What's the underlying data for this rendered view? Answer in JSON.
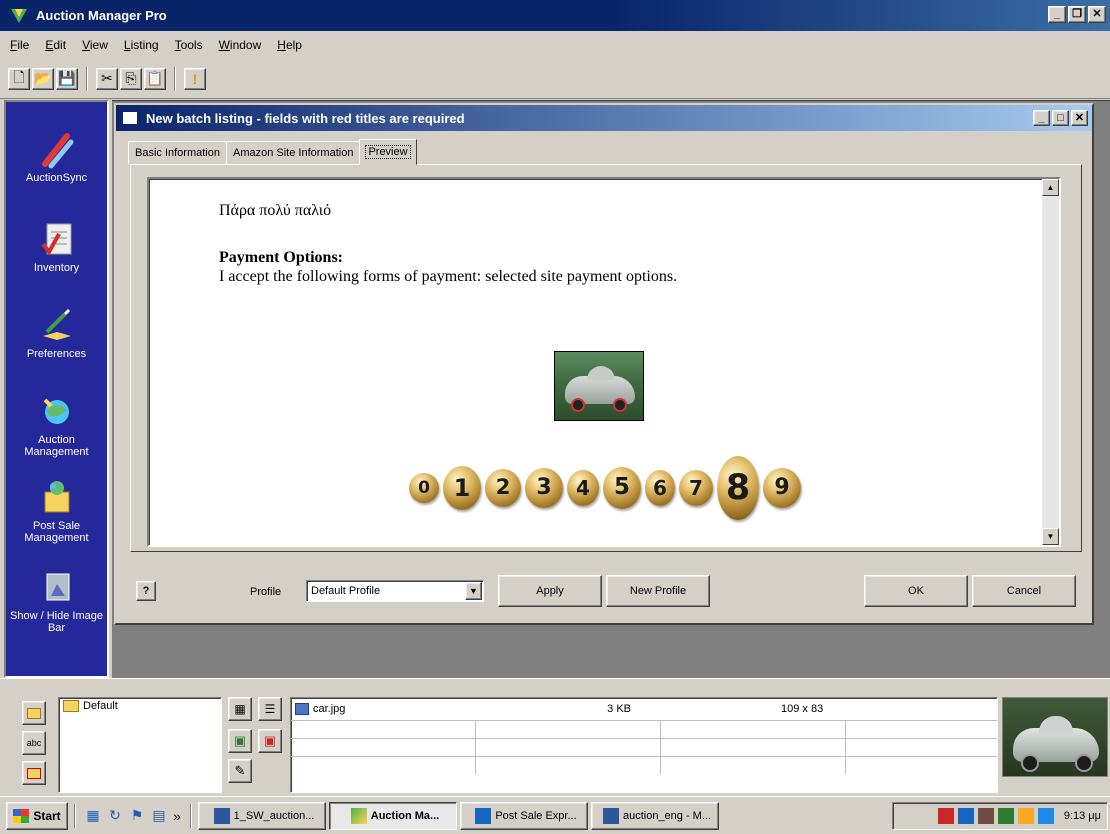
{
  "app": {
    "title": "Auction Manager Pro",
    "menu": [
      "File",
      "Edit",
      "View",
      "Listing",
      "Tools",
      "Window",
      "Help"
    ],
    "toolbar_icons": [
      "new-document-icon",
      "open-folder-icon",
      "save-icon",
      "cut-icon",
      "copy-icon",
      "paste-icon",
      "info-icon"
    ]
  },
  "sidebar": {
    "items": [
      {
        "label": "AuctionSync",
        "icon": "auctionsync-icon"
      },
      {
        "label": "Inventory",
        "icon": "inventory-icon"
      },
      {
        "label": "Preferences",
        "icon": "preferences-icon"
      },
      {
        "label": "Auction Management",
        "icon": "auction-management-icon"
      },
      {
        "label": "Post Sale Management",
        "icon": "post-sale-icon"
      },
      {
        "label": "Show / Hide Image Bar",
        "icon": "image-bar-icon"
      }
    ]
  },
  "dialog": {
    "title": "New batch listing - fields with red titles are required",
    "tabs": [
      "Basic Information",
      "Amazon Site Information",
      "Preview"
    ],
    "active_tab": "Preview",
    "preview": {
      "greek_text": "Πάρα πολύ παλιό",
      "payment_heading": "Payment Options:",
      "payment_text": "I accept the following forms of payment: selected site payment options.",
      "counter_digits": [
        "0",
        "1",
        "2",
        "3",
        "4",
        "5",
        "6",
        "7",
        "8",
        "9"
      ]
    },
    "profile_label": "Profile",
    "profile_value": "Default Profile",
    "buttons": {
      "apply": "Apply",
      "new_profile": "New Profile",
      "ok": "OK",
      "cancel": "Cancel"
    }
  },
  "imagebar": {
    "folder": "Default",
    "file": {
      "name": "car.jpg",
      "size": "3 KB",
      "dimensions": "109 x 83"
    }
  },
  "taskbar": {
    "start": "Start",
    "tasks": [
      "1_SW_auction...",
      "Auction Ma...",
      "Post Sale Expr...",
      "auction_eng - M..."
    ],
    "active_task": "Auction Ma...",
    "clock": "9:13 μμ"
  },
  "colors": {
    "titlebar": "#0a246a",
    "sidebar": "#25289a",
    "face": "#d4d0c8"
  }
}
